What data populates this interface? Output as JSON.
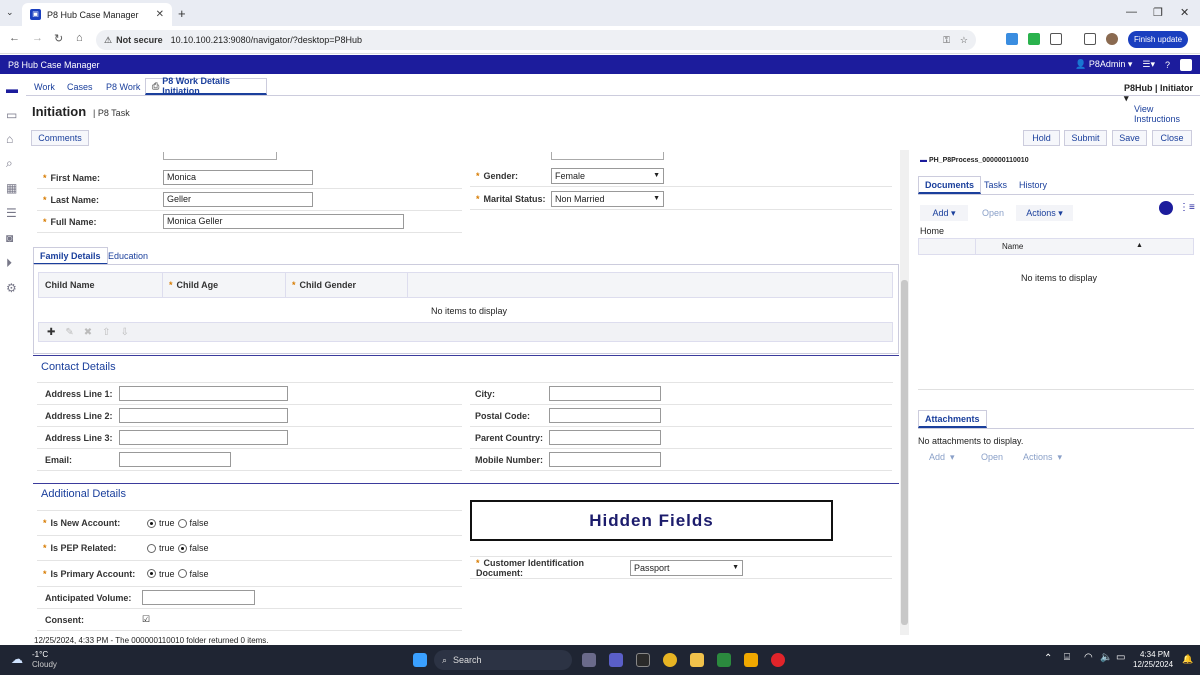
{
  "browser": {
    "tab_title": "P8 Hub Case Manager",
    "not_secure": "Not secure",
    "url": "10.10.100.213:9080/navigator/?desktop=P8Hub",
    "finish_update": "Finish update"
  },
  "app": {
    "header_title": "P8 Hub Case Manager",
    "user": "P8Admin",
    "hub_user": "P8Hub | Initiator",
    "tabs": [
      "Work",
      "Cases",
      "P8 Work",
      "P8 Work Details Initiation"
    ],
    "page_title": "Initiation",
    "page_subtitle": "| P8 Task",
    "view_instructions": "View Instructions",
    "comments": "Comments",
    "actions": [
      "Hold",
      "Submit",
      "Save",
      "Close"
    ]
  },
  "personal": {
    "first_name_label": "First Name:",
    "first_name": "Monica",
    "last_name_label": "Last Name:",
    "last_name": "Geller",
    "full_name_label": "Full Name:",
    "full_name": "Monica Geller",
    "gender_label": "Gender:",
    "gender": "Female",
    "marital_label": "Marital Status:",
    "marital": "Non Married"
  },
  "family": {
    "tabs": [
      "Family Details",
      "Education"
    ],
    "columns": [
      "Child Name",
      "Child Age",
      "Child Gender"
    ],
    "empty": "No items to display"
  },
  "contact": {
    "title": "Contact Details",
    "left": [
      "Address Line 1:",
      "Address Line 2:",
      "Address Line 3:",
      "Email:"
    ],
    "right": [
      "City:",
      "Postal Code:",
      "Parent Country:",
      "Mobile Number:"
    ]
  },
  "additional": {
    "title": "Additional Details",
    "new_account": "Is New Account:",
    "pep": "Is PEP Related:",
    "primary": "Is Primary Account:",
    "volume": "Anticipated Volume:",
    "consent": "Consent:",
    "true_label": "true",
    "false_label": "false",
    "hidden_fields": "Hidden Fields",
    "cid_label": "Customer Identification Document:",
    "cid_value": "Passport"
  },
  "right_panel": {
    "folder": "PH_P8Process_000000110010",
    "tabs": [
      "Documents",
      "Tasks",
      "History"
    ],
    "add": "Add",
    "open": "Open",
    "actions": "Actions",
    "home": "Home",
    "name_col": "Name",
    "empty": "No items to display",
    "attachments_tab": "Attachments",
    "no_attach": "No attachments to display."
  },
  "status_line": "12/25/2024, 4:33 PM - The 000000110010 folder returned 0 items.",
  "taskbar": {
    "temp": "-1°C",
    "weather": "Cloudy",
    "search": "Search",
    "time": "4:34 PM",
    "date": "12/25/2024"
  }
}
